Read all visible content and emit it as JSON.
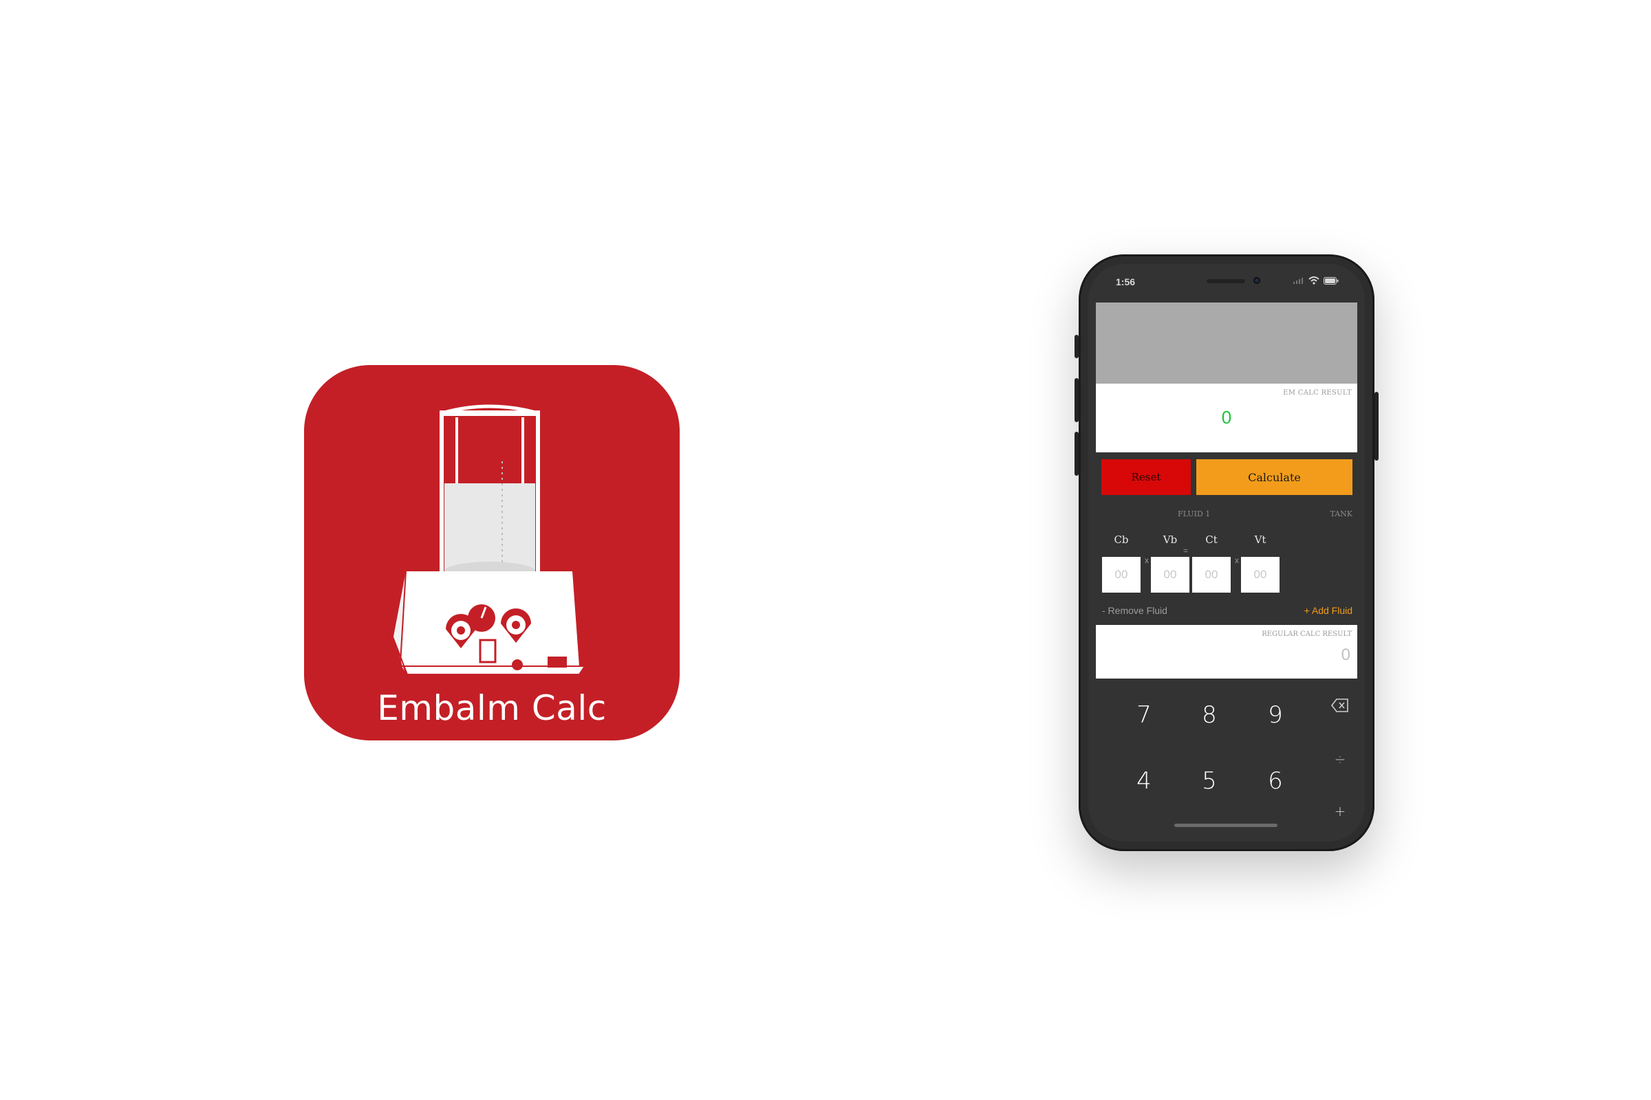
{
  "app_icon": {
    "name": "Embalm Calc",
    "background_color": "#c41f26",
    "icon": "embalming-machine-icon"
  },
  "status_bar": {
    "time": "1:56",
    "icons": [
      "signal-icon",
      "wifi-icon",
      "battery-icon"
    ]
  },
  "em_result": {
    "label": "EM CALC RESULT",
    "value": "0",
    "value_color": "#1cc43a"
  },
  "actions": {
    "reset_label": "Reset",
    "calculate_label": "Calculate",
    "reset_color": "#d80808",
    "calculate_color": "#f39c1b"
  },
  "formula": {
    "fluid_caption": "FLUID 1",
    "tank_caption": "TANK",
    "fields": [
      {
        "label": "Cb",
        "placeholder": "00"
      },
      {
        "label": "Vb",
        "placeholder": "00"
      },
      {
        "label": "Ct",
        "placeholder": "00"
      },
      {
        "label": "Vt",
        "placeholder": "00"
      }
    ],
    "operators": [
      "x",
      "=",
      "x"
    ]
  },
  "fluid_links": {
    "remove": "- Remove Fluid",
    "add": "+ Add Fluid"
  },
  "regular_result": {
    "label": "REGULAR CALC RESULT",
    "value": "0"
  },
  "keypad": {
    "row1": [
      "7",
      "8",
      "9"
    ],
    "row2": [
      "4",
      "5",
      "6"
    ],
    "delete_icon": "backspace-icon",
    "divide": "÷",
    "plus": "+"
  }
}
